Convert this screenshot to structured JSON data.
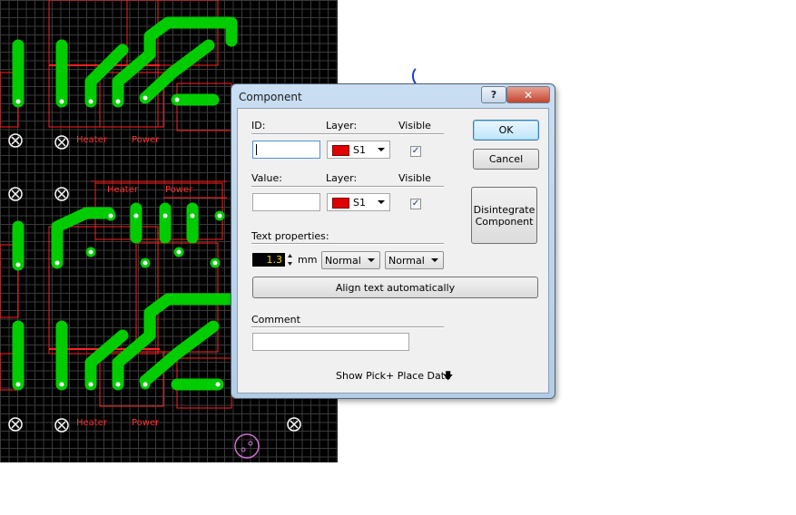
{
  "window": {
    "title": "Component",
    "help_glyph": "?",
    "close_glyph": "✕"
  },
  "id_section": {
    "id_label": "ID:",
    "layer_label": "Layer:",
    "visible_label": "Visible",
    "id_value": "",
    "layer_value": "S1",
    "visible_checked": true
  },
  "value_section": {
    "value_label": "Value:",
    "layer_label": "Layer:",
    "visible_label": "Visible",
    "value_value": "",
    "layer_value": "S1",
    "visible_checked": true
  },
  "text_properties": {
    "label": "Text properties:",
    "height_value": "1.3",
    "unit": "mm",
    "style1": "Normal",
    "style2": "Normal",
    "align_button": "Align text automatically"
  },
  "comment": {
    "label": "Comment",
    "value": ""
  },
  "buttons": {
    "ok": "OK",
    "cancel": "Cancel",
    "disintegrate": "Disintegrate Component"
  },
  "footer": {
    "show_pick_place": "Show Pick+ Place Data"
  },
  "pcb_labels": {
    "heater": "Heater",
    "power": "Power"
  },
  "colors": {
    "pcb_bg": "#000000",
    "track": "#00cc00",
    "outline": "#ff2020",
    "grid": "#3a3a3a",
    "layer_swatch": "#e00000"
  }
}
